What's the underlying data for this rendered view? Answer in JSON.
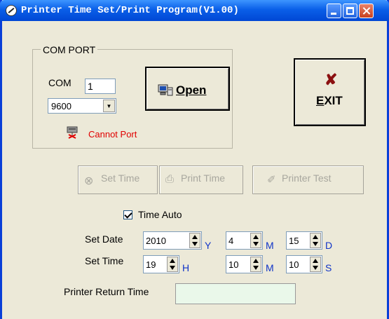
{
  "window": {
    "title": "Printer Time Set/Print Program(V1.00)"
  },
  "com_port": {
    "group_label": "COM PORT",
    "com_label": "COM",
    "com_value": "1",
    "baud_value": "9600",
    "open_label": "Open",
    "status_text": "Cannot Port",
    "status_color": "#E00000"
  },
  "exit_label": "EXIT",
  "actions": {
    "set_time": "Set Time",
    "print_time": "Print Time",
    "printer_test": "Printer Test"
  },
  "time_auto": {
    "label": "Time Auto",
    "checked": true
  },
  "date": {
    "label": "Set Date",
    "year": "2010",
    "year_unit": "Y",
    "month": "4",
    "month_unit": "M",
    "day": "15",
    "day_unit": "D"
  },
  "time": {
    "label": "Set Time",
    "hour": "19",
    "hour_unit": "H",
    "minute": "10",
    "minute_unit": "M",
    "second": "10",
    "second_unit": "S"
  },
  "printer_return": {
    "label": "Printer Return Time",
    "value": ""
  },
  "colors": {
    "titlebar": "#0A5FE8",
    "face": "#ECE9D8",
    "unit_label": "#1034C8",
    "return_box": "#EAF8EA"
  }
}
